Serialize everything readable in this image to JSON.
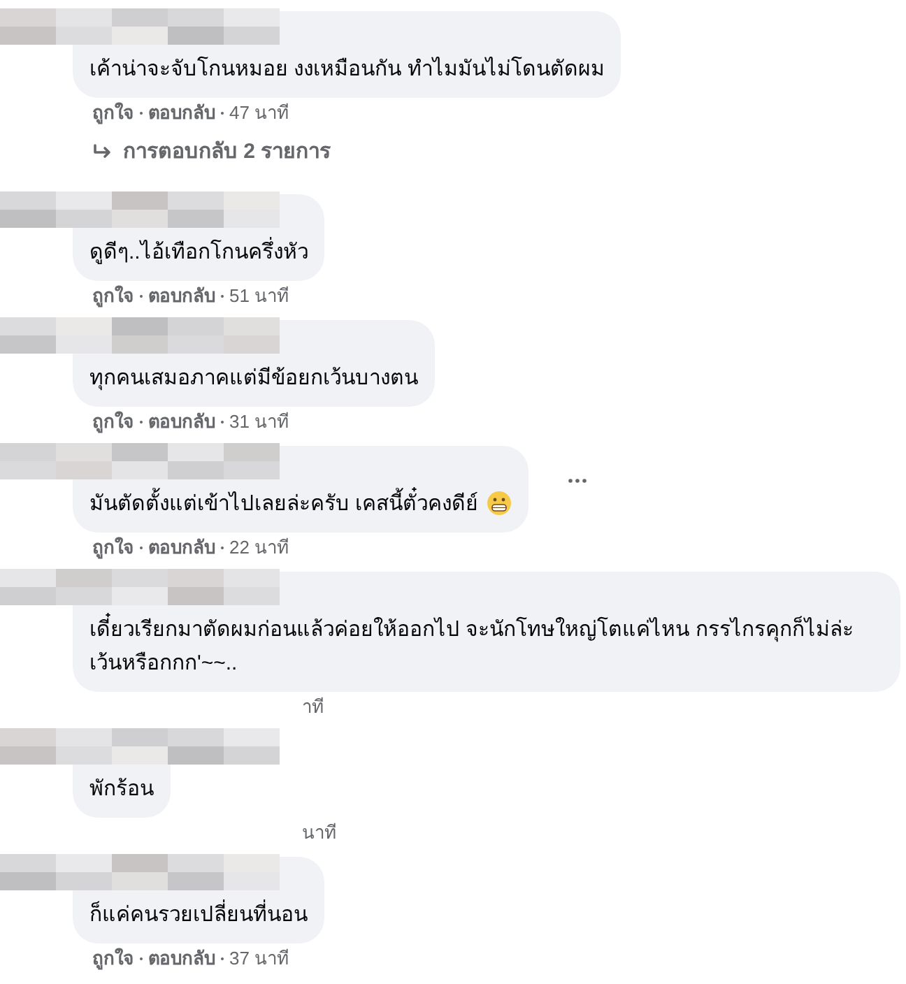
{
  "comments": [
    {
      "text": "เค้าน่าจะจับโกนหมอย งงเหมือนกัน ทำไมมันไม่โดนตัดผม",
      "like": "ถูกใจ",
      "reply": "ตอบกลับ",
      "time": "47 นาที",
      "replies": "การตอบกลับ 2 รายการ"
    },
    {
      "text": "ดูดีๆ..ไอ้เทือกโกนครึ่งหัว",
      "like": "ถูกใจ",
      "reply": "ตอบกลับ",
      "time": "51 นาที"
    },
    {
      "text": "ทุกคนเสมอภาคแต่มีข้อยกเว้นบางตน",
      "like": "ถูกใจ",
      "reply": "ตอบกลับ",
      "time": "31 นาที"
    },
    {
      "text": "มันตัดตั้งแต่เข้าไปเลยล่ะครับ เคสนี้ตั๋วคงดีย์",
      "emoji": true,
      "menu": true,
      "like": "ถูกใจ",
      "reply": "ตอบกลับ",
      "time": "22 นาที"
    },
    {
      "text": "เดี๋ยวเรียกมาตัดผมก่อนแล้วค่อยให้ออกไป จะนักโทษใหญ่โตแค่ไหน กรรไกรคุกก็ไม่ล่ะเว้นหรือกกก'~~..",
      "time": "าที"
    },
    {
      "text": "พักร้อน",
      "time": "นาที"
    },
    {
      "text": "ก็แค่คนรวยเปลี่ยนที่นอน",
      "like": "ถูกใจ",
      "reply": "ตอบกลับ",
      "time": "37 นาที"
    }
  ]
}
